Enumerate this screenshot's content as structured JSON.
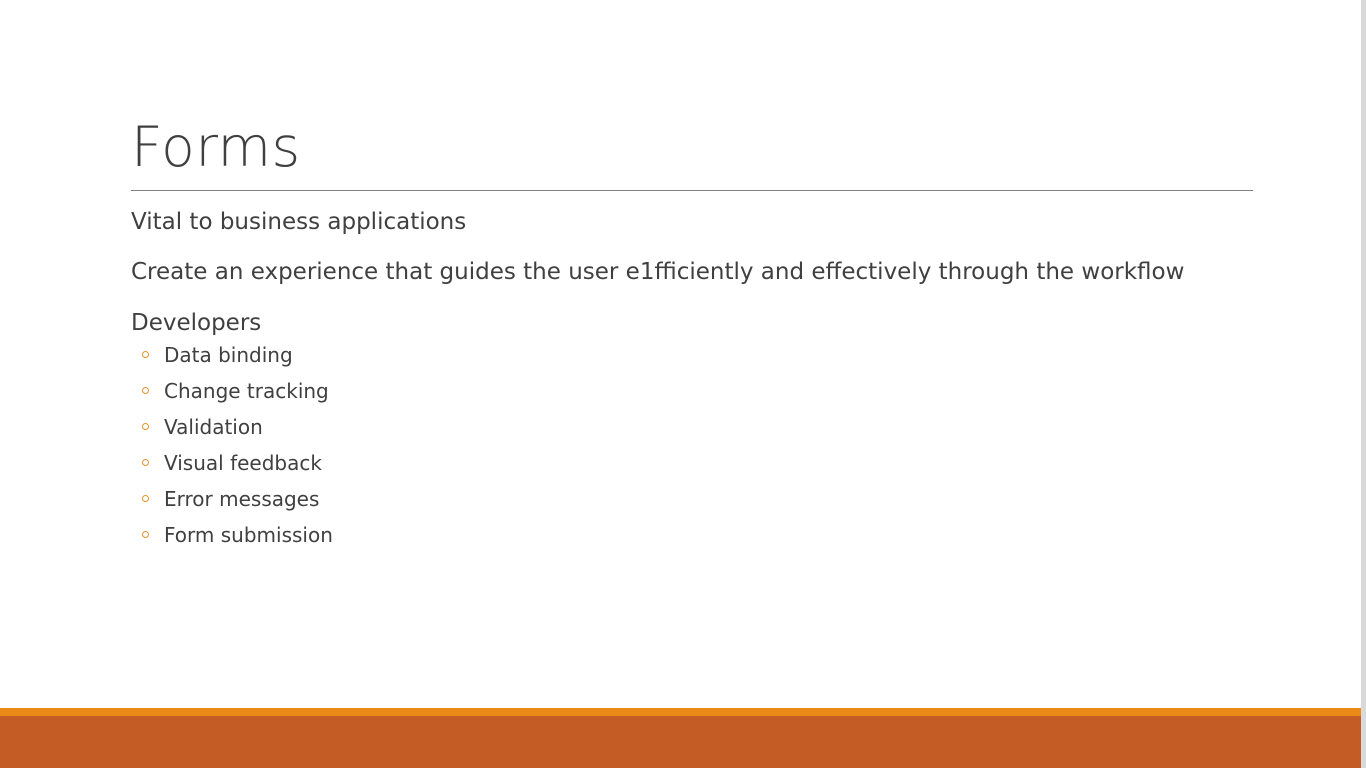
{
  "slide": {
    "title": "Forms",
    "paragraphs": [
      "Vital to business applications",
      "Create an experience that guides the user e1fficiently and effectively through the workflow",
      "Developers"
    ],
    "bullets": [
      "Data binding",
      "Change tracking",
      "Validation",
      "Visual feedback",
      "Error messages",
      "Form submission"
    ]
  },
  "colors": {
    "text": "#404040",
    "bullet_accent": "#e8912d",
    "footer_line": "#ec8a17",
    "footer_bar": "#c45c26"
  },
  "icons": {
    "bullet": "hollow-circle-icon"
  }
}
